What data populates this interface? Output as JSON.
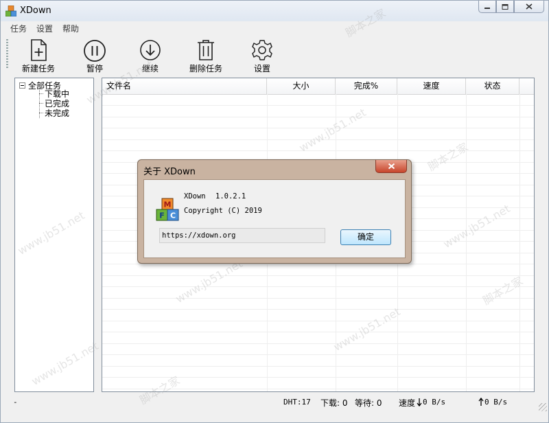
{
  "window": {
    "title": "XDown"
  },
  "menu": [
    "任务",
    "设置",
    "帮助"
  ],
  "toolbar": {
    "new_task": "新建任务",
    "pause": "暂停",
    "resume": "继续",
    "delete_task": "删除任务",
    "settings": "设置"
  },
  "tree": {
    "root": "全部任务",
    "children": [
      "下载中",
      "已完成",
      "未完成"
    ]
  },
  "table": {
    "columns": [
      "文件名",
      "大小",
      "完成%",
      "速度",
      "状态"
    ]
  },
  "status": {
    "left": "-",
    "dht": "DHT:17",
    "download": "下载: 0",
    "waiting": "等待: 0",
    "speed_label": "速度",
    "down_speed": "0 B/s",
    "up_speed": "0 B/s"
  },
  "dialog": {
    "title": "关于 XDown",
    "app_name": "XDown",
    "version": "1.0.2.1",
    "copyright": "Copyright (C) 2019",
    "url": "https://xdown.org",
    "ok_label": "确定",
    "logo_letters": [
      "M",
      "F",
      "C"
    ]
  },
  "watermarks": [
    "www.jb51.net",
    "脚本之家"
  ]
}
